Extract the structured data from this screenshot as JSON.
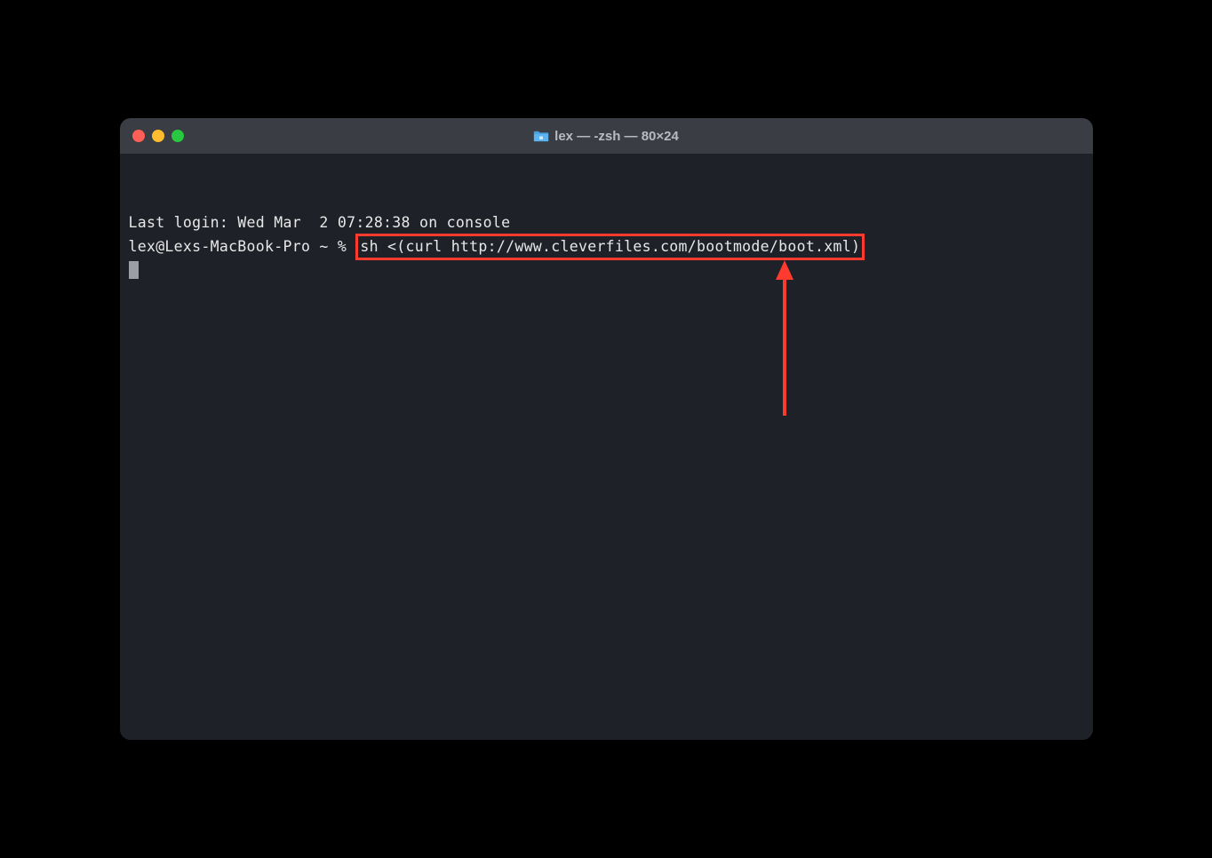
{
  "window": {
    "title": "lex — -zsh — 80×24"
  },
  "terminal": {
    "last_login": "Last login: Wed Mar  2 07:28:38 on console",
    "prompt": "lex@Lexs-MacBook-Pro ~ % ",
    "command": "sh <(curl http://www.cleverfiles.com/bootmode/boot.xml)"
  },
  "colors": {
    "highlight_border": "#ff3b30",
    "arrow": "#ff3b30"
  }
}
